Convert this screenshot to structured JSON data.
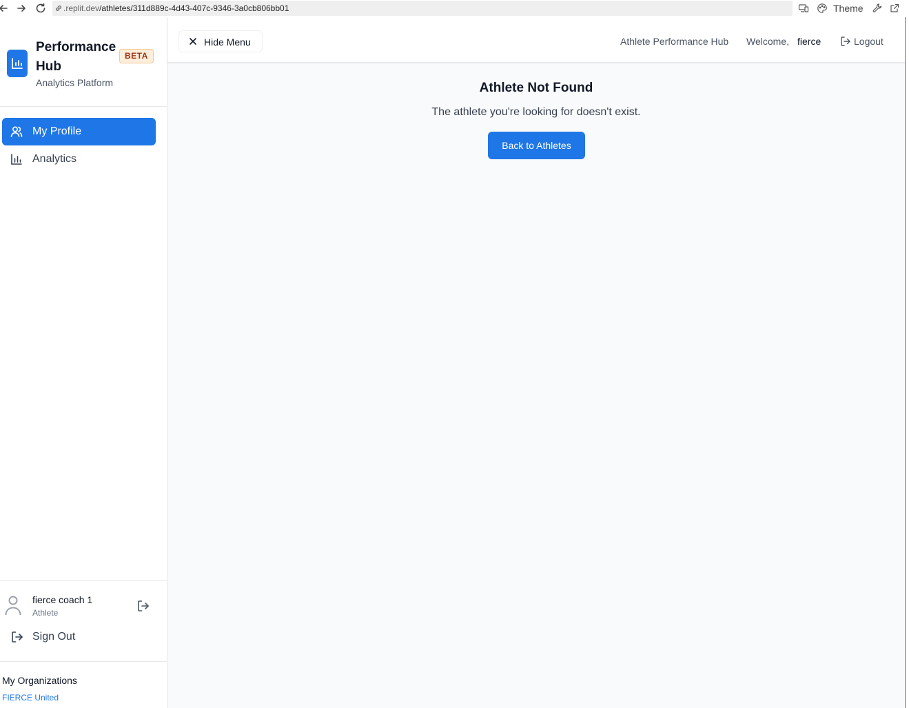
{
  "browser": {
    "url_host": ".replit.dev",
    "url_path": "/athletes/311d889c-4d43-407c-9346-3a0cb806bb01",
    "theme_label": "Theme"
  },
  "sidebar": {
    "brand_title": "Performance Hub",
    "beta_badge": "BETA",
    "brand_subtitle": "Analytics Platform",
    "items": [
      {
        "label": "My Profile",
        "icon": "users-icon",
        "active": true
      },
      {
        "label": "Analytics",
        "icon": "bar-chart-icon",
        "active": false
      }
    ],
    "user": {
      "name": "fierce coach 1",
      "role": "Athlete"
    },
    "sign_out_label": "Sign Out",
    "organizations_title": "My Organizations",
    "organizations": [
      "FIERCE United"
    ]
  },
  "header": {
    "hide_menu_label": "Hide Menu",
    "app_name": "Athlete Performance Hub",
    "welcome_label": "Welcome,",
    "username": "fierce",
    "logout_label": "Logout"
  },
  "main": {
    "title": "Athlete Not Found",
    "message": "The athlete you're looking for doesn't exist.",
    "back_button_label": "Back to Athletes"
  },
  "colors": {
    "accent": "#1f76e6",
    "beta_bg": "#fdeedb",
    "beta_text": "#9a3412",
    "content_bg": "#f9fafb"
  }
}
